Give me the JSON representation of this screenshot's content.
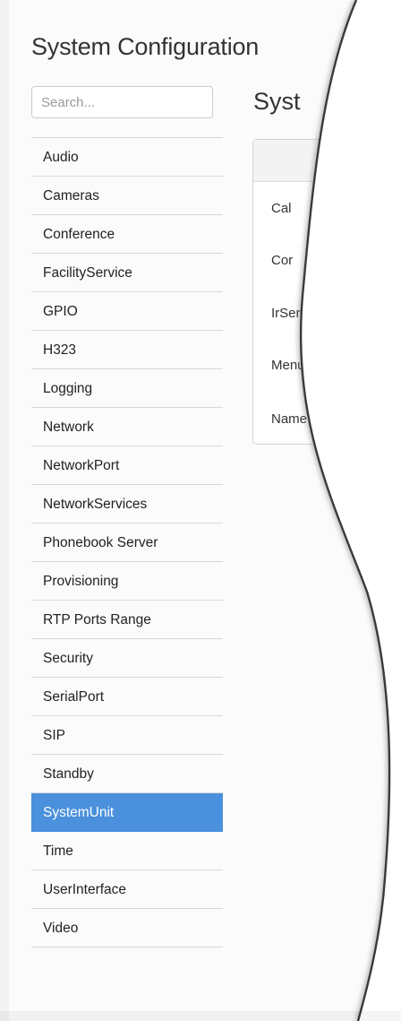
{
  "page_title": "System Configuration",
  "search": {
    "placeholder": "Search..."
  },
  "sidebar": {
    "items": [
      {
        "label": "Audio"
      },
      {
        "label": "Cameras"
      },
      {
        "label": "Conference"
      },
      {
        "label": "FacilityService"
      },
      {
        "label": "GPIO"
      },
      {
        "label": "H323"
      },
      {
        "label": "Logging"
      },
      {
        "label": "Network"
      },
      {
        "label": "NetworkPort"
      },
      {
        "label": "NetworkServices"
      },
      {
        "label": "Phonebook Server"
      },
      {
        "label": "Provisioning"
      },
      {
        "label": "RTP Ports Range"
      },
      {
        "label": "Security"
      },
      {
        "label": "SerialPort"
      },
      {
        "label": "SIP"
      },
      {
        "label": "Standby"
      },
      {
        "label": "SystemUnit",
        "selected": true
      },
      {
        "label": "Time"
      },
      {
        "label": "UserInterface"
      },
      {
        "label": "Video"
      }
    ]
  },
  "main": {
    "title_visible": "Syst",
    "card_rows": [
      {
        "label": "Cal"
      },
      {
        "label": "Cor"
      },
      {
        "label": "IrSer"
      },
      {
        "label": "Menu"
      },
      {
        "label": "Name"
      }
    ]
  },
  "colors": {
    "selected_bg": "#4a90dc",
    "selected_text": "#ffffff"
  }
}
